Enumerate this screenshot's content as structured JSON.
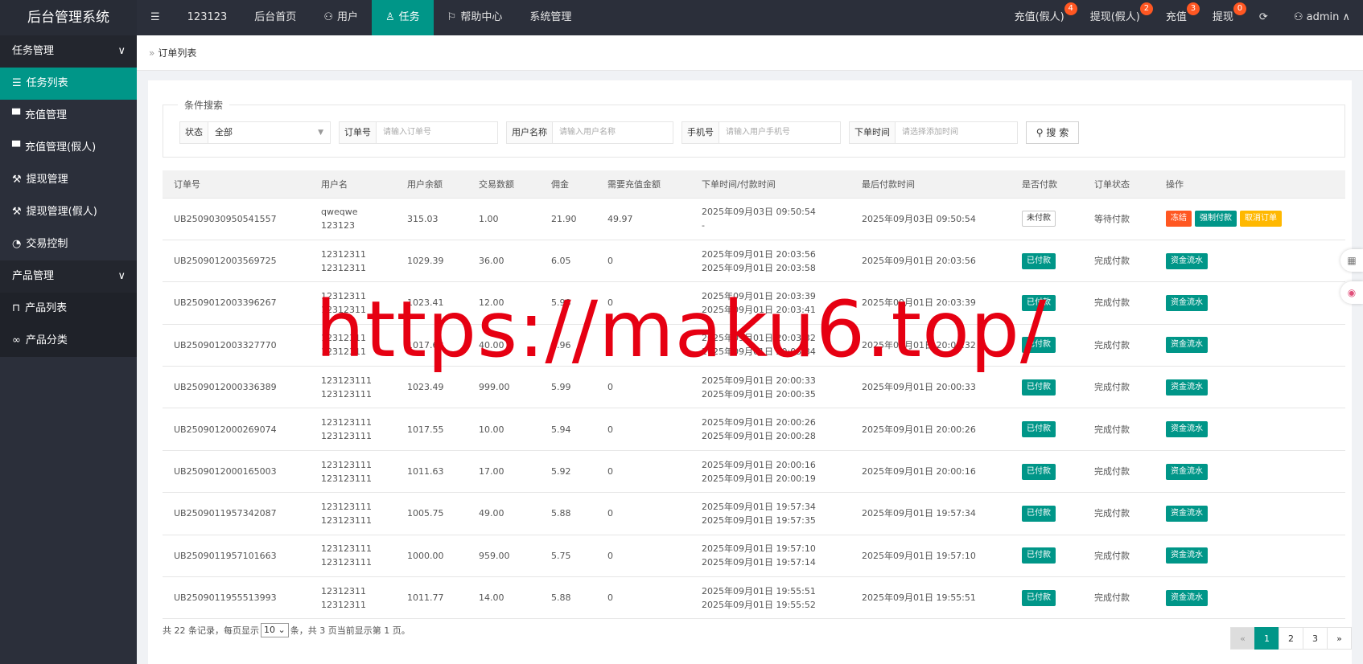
{
  "brand": "后台管理系统",
  "topnav": [
    {
      "label": "123123",
      "icon": ""
    },
    {
      "label": "后台首页",
      "icon": ""
    },
    {
      "label": "用户",
      "icon": "user-icon"
    },
    {
      "label": "任务",
      "icon": "task-icon",
      "active": true
    },
    {
      "label": "帮助中心",
      "icon": "flag-icon"
    },
    {
      "label": "系统管理",
      "icon": ""
    }
  ],
  "topright": [
    {
      "label": "充值(假人)",
      "badge": "4"
    },
    {
      "label": "提现(假人)",
      "badge": "2"
    },
    {
      "label": "充值",
      "badge": "3"
    },
    {
      "label": "提现",
      "badge": "0"
    }
  ],
  "user": "admin",
  "sidebar": {
    "group1": "任务管理",
    "items1": [
      "任务列表",
      "充值管理",
      "充值管理(假人)",
      "提现管理",
      "提现管理(假人)",
      "交易控制"
    ],
    "group2": "产品管理",
    "items2": [
      "产品列表",
      "产品分类"
    ]
  },
  "breadcrumb": "订单列表",
  "search": {
    "legend": "条件搜索",
    "status_label": "状态",
    "status_value": "全部",
    "order_label": "订单号",
    "order_ph": "请输入订单号",
    "user_label": "用户名称",
    "user_ph": "请输入用户名称",
    "phone_label": "手机号",
    "phone_ph": "请输入用户手机号",
    "time_label": "下单时间",
    "time_ph": "请选择添加时间",
    "button": "搜 索"
  },
  "table": {
    "headers": [
      "订单号",
      "用户名",
      "用户余额",
      "交易数额",
      "佣金",
      "需要充值金额",
      "下单时间/付款时间",
      "最后付款时间",
      "是否付款",
      "订单状态",
      "操作"
    ],
    "rows": [
      {
        "id": "UB2509030950541557",
        "u1": "qweqwe",
        "u2": "123123",
        "bal": "315.03",
        "amt": "1.00",
        "com": "21.90",
        "need": "49.97",
        "t1": "2025年09月03日 09:50:54",
        "t2": "-",
        "last": "2025年09月03日 09:50:54",
        "pay": "未付款",
        "status": "等待付款",
        "ops": [
          "冻结",
          "强制付款",
          "取消订单"
        ]
      },
      {
        "id": "UB2509012003569725",
        "u1": "12312311",
        "u2": "12312311",
        "bal": "1029.39",
        "amt": "36.00",
        "com": "6.05",
        "need": "0",
        "t1": "2025年09月01日 20:03:56",
        "t2": "2025年09月01日 20:03:58",
        "last": "2025年09月01日 20:03:56",
        "pay": "已付款",
        "status": "完成付款",
        "ops": [
          "资金流水"
        ]
      },
      {
        "id": "UB2509012003396267",
        "u1": "12312311",
        "u2": "12312311",
        "bal": "1023.41",
        "amt": "12.00",
        "com": "5.98",
        "need": "0",
        "t1": "2025年09月01日 20:03:39",
        "t2": "2025年09月01日 20:03:41",
        "last": "2025年09月01日 20:03:39",
        "pay": "已付款",
        "status": "完成付款",
        "ops": [
          "资金流水"
        ]
      },
      {
        "id": "UB2509012003327770",
        "u1": "12312311",
        "u2": "12312311",
        "bal": "1017.63",
        "amt": "40.00",
        "com": "5.96",
        "need": "0",
        "t1": "2025年09月01日 20:03:32",
        "t2": "2025年09月01日 20:03:34",
        "last": "2025年09月01日 20:03:32",
        "pay": "已付款",
        "status": "完成付款",
        "ops": [
          "资金流水"
        ]
      },
      {
        "id": "UB2509012000336389",
        "u1": "123123111",
        "u2": "123123111",
        "bal": "1023.49",
        "amt": "999.00",
        "com": "5.99",
        "need": "0",
        "t1": "2025年09月01日 20:00:33",
        "t2": "2025年09月01日 20:00:35",
        "last": "2025年09月01日 20:00:33",
        "pay": "已付款",
        "status": "完成付款",
        "ops": [
          "资金流水"
        ]
      },
      {
        "id": "UB2509012000269074",
        "u1": "123123111",
        "u2": "123123111",
        "bal": "1017.55",
        "amt": "10.00",
        "com": "5.94",
        "need": "0",
        "t1": "2025年09月01日 20:00:26",
        "t2": "2025年09月01日 20:00:28",
        "last": "2025年09月01日 20:00:26",
        "pay": "已付款",
        "status": "完成付款",
        "ops": [
          "资金流水"
        ]
      },
      {
        "id": "UB2509012000165003",
        "u1": "123123111",
        "u2": "123123111",
        "bal": "1011.63",
        "amt": "17.00",
        "com": "5.92",
        "need": "0",
        "t1": "2025年09月01日 20:00:16",
        "t2": "2025年09月01日 20:00:19",
        "last": "2025年09月01日 20:00:16",
        "pay": "已付款",
        "status": "完成付款",
        "ops": [
          "资金流水"
        ]
      },
      {
        "id": "UB2509011957342087",
        "u1": "123123111",
        "u2": "123123111",
        "bal": "1005.75",
        "amt": "49.00",
        "com": "5.88",
        "need": "0",
        "t1": "2025年09月01日 19:57:34",
        "t2": "2025年09月01日 19:57:35",
        "last": "2025年09月01日 19:57:34",
        "pay": "已付款",
        "status": "完成付款",
        "ops": [
          "资金流水"
        ]
      },
      {
        "id": "UB2509011957101663",
        "u1": "123123111",
        "u2": "123123111",
        "bal": "1000.00",
        "amt": "959.00",
        "com": "5.75",
        "need": "0",
        "t1": "2025年09月01日 19:57:10",
        "t2": "2025年09月01日 19:57:14",
        "last": "2025年09月01日 19:57:10",
        "pay": "已付款",
        "status": "完成付款",
        "ops": [
          "资金流水"
        ]
      },
      {
        "id": "UB2509011955513993",
        "u1": "12312311",
        "u2": "12312311",
        "bal": "1011.77",
        "amt": "14.00",
        "com": "5.88",
        "need": "0",
        "t1": "2025年09月01日 19:55:51",
        "t2": "2025年09月01日 19:55:52",
        "last": "2025年09月01日 19:55:51",
        "pay": "已付款",
        "status": "完成付款",
        "ops": [
          "资金流水"
        ]
      }
    ]
  },
  "footer": {
    "pre": "共 22 条记录，每页显示",
    "page_size": "10",
    "post": "条，共 3 页当前显示第 1 页。"
  },
  "pager": {
    "prev": "«",
    "pages": [
      "1",
      "2",
      "3"
    ],
    "next": "»",
    "current": "1"
  },
  "watermark": "https://maku6.top/",
  "colors": {
    "primary": "#009688",
    "danger": "#ff5722",
    "warn": "#ffb800",
    "dark": "#2b2f3a"
  }
}
